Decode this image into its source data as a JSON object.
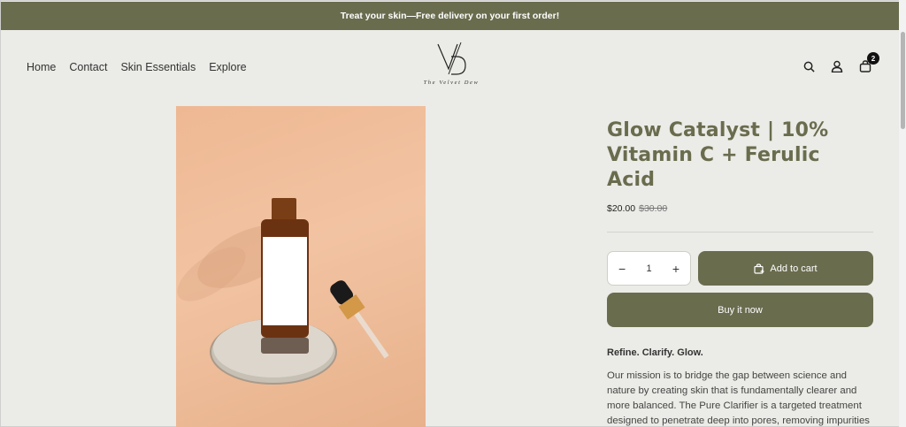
{
  "announcement": "Treat your skin—Free delivery on your first order!",
  "nav": [
    "Home",
    "Contact",
    "Skin Essentials",
    "Explore"
  ],
  "logo": {
    "monogram": "V/D",
    "text": "The Velvet Dew"
  },
  "icons": {
    "search": "search-icon",
    "account": "user-icon",
    "cart": "cart-icon"
  },
  "cart": {
    "count": "2"
  },
  "product": {
    "title": "Glow Catalyst | 10% Vitamin C + Ferulic Acid",
    "price": "$20.00",
    "compare_price": "$30.00",
    "quantity": "1",
    "add_to_cart": "Add to cart",
    "buy_now": "Buy it now",
    "tagline": "Refine. Clarify. Glow.",
    "description": "Our mission is to bridge the gap between science and nature by creating skin that is fundamentally clearer and more balanced. The Pure Clarifier is a targeted treatment designed to penetrate deep into pores, removing impurities while maintaining the velvet-smooth radiance"
  },
  "colors": {
    "accent": "#6a6c4e",
    "background": "#ebebe7"
  }
}
